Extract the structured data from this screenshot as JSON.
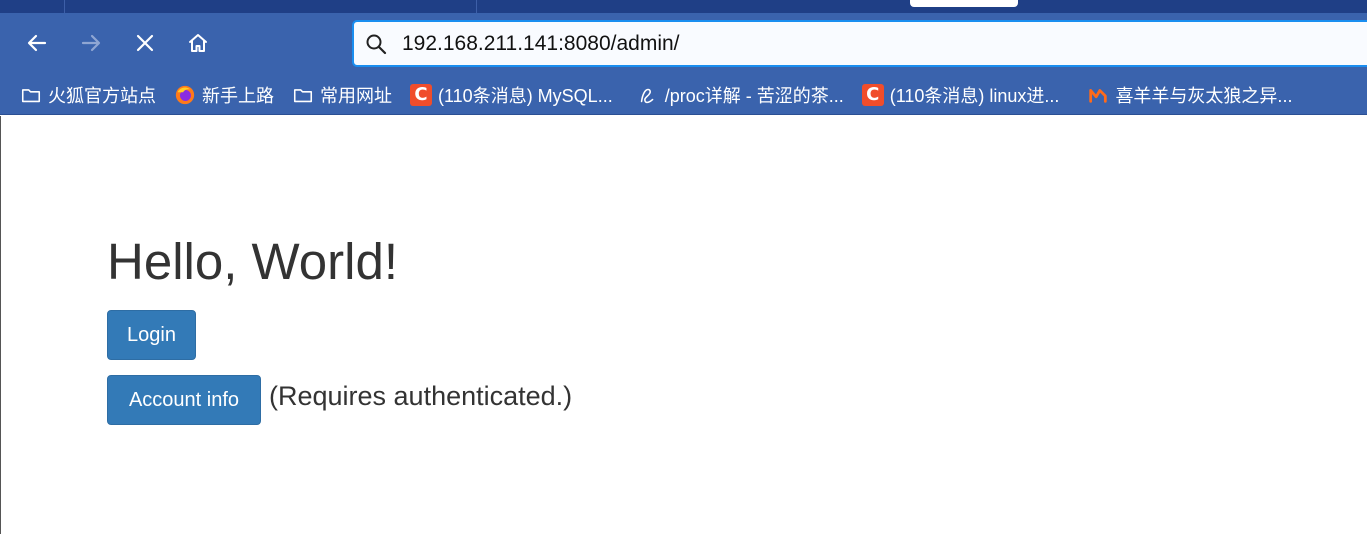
{
  "browser": {
    "url": "192.168.211.141:8080/admin/",
    "nav": {
      "back_icon": "arrow-left-icon",
      "forward_icon": "arrow-right-icon",
      "stop_icon": "close-icon",
      "home_icon": "home-icon",
      "search_icon": "search-icon"
    },
    "bookmarks": [
      {
        "label": "火狐官方站点",
        "icon": "folder-icon"
      },
      {
        "label": "新手上路",
        "icon": "firefox-icon"
      },
      {
        "label": "常用网址",
        "icon": "folder-icon"
      },
      {
        "label": "(110条消息) MySQL...",
        "icon": "csdn-icon"
      },
      {
        "label": "/proc详解 - 苦涩的茶...",
        "icon": "cnblogs-icon"
      },
      {
        "label": "(110条消息) linux进...",
        "icon": "csdn-icon"
      },
      {
        "label": "喜羊羊与灰太狼之异...",
        "icon": "mango-icon"
      }
    ],
    "colors": {
      "toolbar": "#3a63ad",
      "tabstrip": "#1f3f86",
      "url_focus": "#1a8ef0"
    }
  },
  "page": {
    "title": "Hello, World!",
    "login_label": "Login",
    "account_label": "Account info",
    "account_note": "(Requires authenticated.)",
    "button_color": "#337ab7"
  }
}
